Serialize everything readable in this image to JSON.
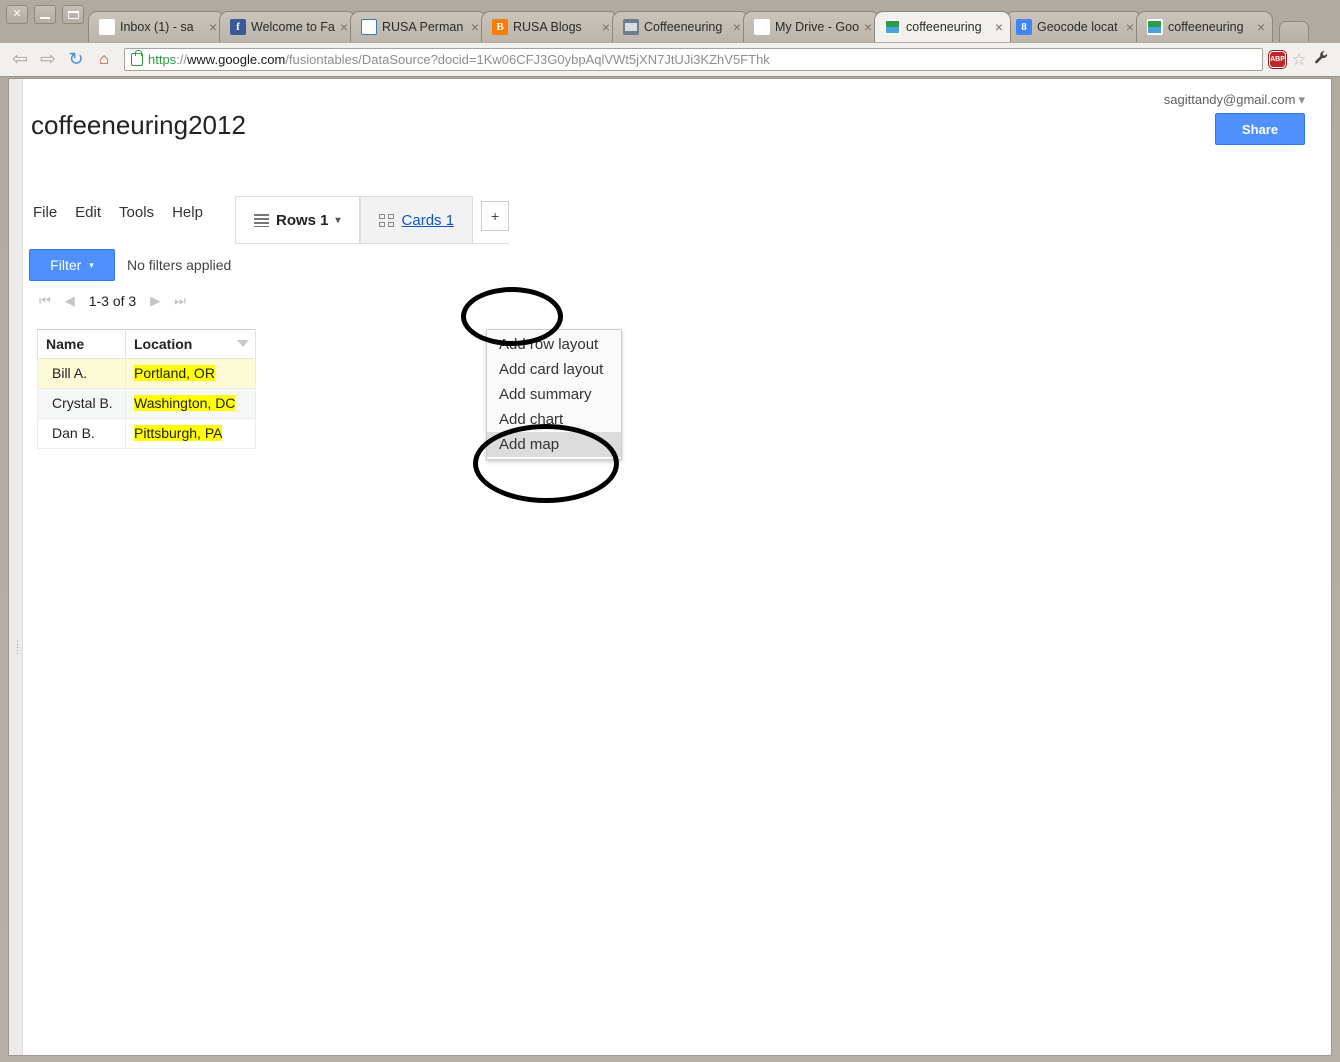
{
  "browser": {
    "window_controls": [
      "close",
      "minimize",
      "maximize"
    ],
    "tabs": [
      {
        "title": "Inbox (1) - sa",
        "favicon": "gmail-icon",
        "active": false
      },
      {
        "title": "Welcome to Fa",
        "favicon": "facebook-icon",
        "active": false
      },
      {
        "title": "RUSA Perman",
        "favicon": "rusa-icon",
        "active": false
      },
      {
        "title": "RUSA Blogs",
        "favicon": "blogger-icon",
        "active": false
      },
      {
        "title": "Coffeeneuring",
        "favicon": "photo-icon",
        "active": false
      },
      {
        "title": "My Drive - Goo",
        "favicon": "google-drive-icon",
        "active": false
      },
      {
        "title": "coffeeneuring",
        "favicon": "fusion-tables-icon",
        "active": true
      },
      {
        "title": "Geocode locat",
        "favicon": "google-icon",
        "active": false
      },
      {
        "title": "coffeeneuring",
        "favicon": "fusion-tables-icon",
        "active": false
      }
    ],
    "tab_close_glyph": "×",
    "new_tab_label": "",
    "nav": {
      "back_glyph": "⇦",
      "forward_glyph": "⇨",
      "reload_glyph": "↻",
      "home_glyph": "⌂"
    },
    "omnibox": {
      "scheme": "https",
      "separator": "://",
      "host": "www.google.com",
      "path": "/fusiontables/DataSource?docid=1Kw06CFJ3G0ybpAqlVWt5jXN7JtUJi3KZhV5FThk",
      "full_url": "https://www.google.com/fusiontables/DataSource?docid=1Kw06CFJ3G0ybpAqlVWt5jXN7JtUJi3KZhV5FThk",
      "lock": "secure-lock-icon"
    },
    "extensions": {
      "adblock_label": "ABP",
      "bookmark_glyph": "☆"
    },
    "menu_glyph": "🔧"
  },
  "app": {
    "account_email": "sagittandy@gmail.com",
    "account_caret": "▾",
    "share_label": "Share",
    "document_title": "coffeeneuring2012",
    "menubar": [
      "File",
      "Edit",
      "Tools",
      "Help"
    ],
    "view_tabs": [
      {
        "label": "Rows 1",
        "icon": "rows-icon",
        "active": true,
        "caret": "▾"
      },
      {
        "label": "Cards 1",
        "icon": "cards-icon",
        "active": false,
        "caret": ""
      }
    ],
    "add_view_button": "+",
    "dropdown_menu": {
      "items": [
        {
          "label": "Add row layout",
          "highlighted": false
        },
        {
          "label": "Add card layout",
          "highlighted": false
        },
        {
          "label": "Add summary",
          "highlighted": false
        },
        {
          "label": "Add chart",
          "highlighted": false
        },
        {
          "label": "Add map",
          "highlighted": true
        }
      ]
    },
    "filter": {
      "button_label": "Filter",
      "caret": "▾",
      "status_text": "No filters applied"
    },
    "pagination": {
      "first_glyph": "⏮",
      "prev_glyph": "◀",
      "range_text": "1-3 of 3",
      "next_glyph": "▶",
      "last_glyph": "⏭"
    },
    "table": {
      "columns": [
        "Name",
        "Location"
      ],
      "sort_caret": "▼",
      "rows": [
        {
          "name": "Bill A.",
          "location": "Portland, OR",
          "highlighted_row": true
        },
        {
          "name": "Crystal B.",
          "location": "Washington, DC",
          "highlighted_row": false
        },
        {
          "name": "Dan B.",
          "location": "Pittsburgh, PA",
          "highlighted_row": false
        }
      ]
    },
    "annotations": [
      {
        "name": "circle-around-add-view-button",
        "shape": "ellipse",
        "color": "#000000"
      },
      {
        "name": "circle-around-add-map-item",
        "shape": "ellipse",
        "color": "#000000"
      }
    ]
  },
  "colors": {
    "accent_blue": "#4d90fe",
    "link_blue": "#1155cc",
    "highlight_yellow": "#ffff00",
    "row_selected": "#fdfbd6",
    "annotation_black": "#000000"
  }
}
